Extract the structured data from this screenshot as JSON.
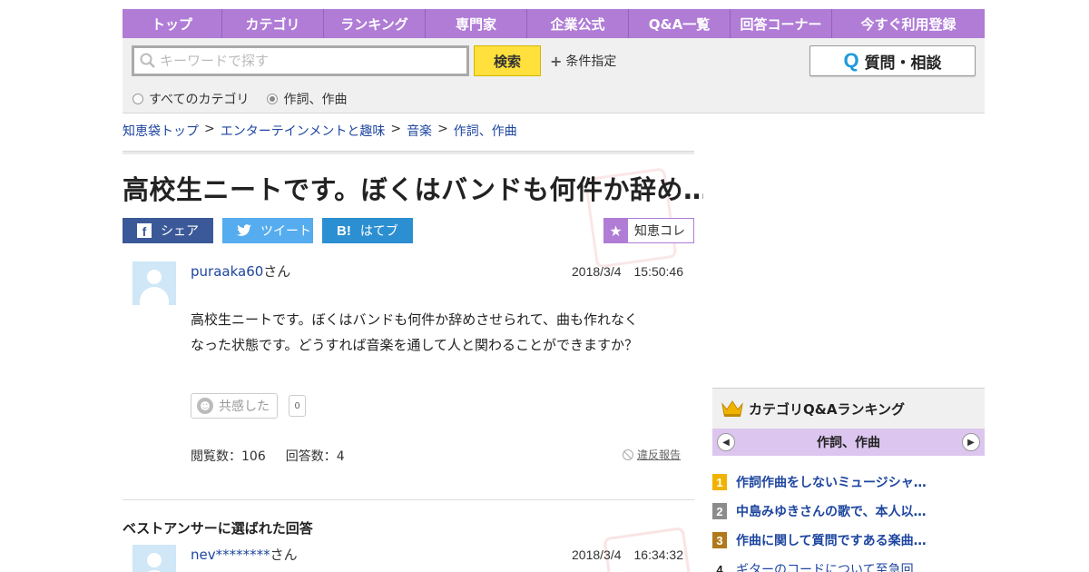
{
  "nav": {
    "items": [
      "トップ",
      "カテゴリ",
      "ランキング",
      "専門家",
      "企業公式",
      "Q&A一覧",
      "回答コーナー",
      "今すぐ利用登録"
    ]
  },
  "search": {
    "placeholder": "キーワードで探す",
    "button": "検索",
    "conditions": "条件指定",
    "ask_button": "質問・相談",
    "ask_icon": "Q",
    "scope_all": "すべてのカテゴリ",
    "scope_current": "作詞、作曲"
  },
  "breadcrumb": [
    "知恵袋トップ",
    "エンターテインメントと趣味",
    "音楽",
    "作詞、作曲"
  ],
  "question": {
    "title": "高校生ニートです。ぼくはバンドも何件か辞め…",
    "user": "puraaka60",
    "honorific": "さん",
    "date": "2018/3/4　15:50:46",
    "body_line1": "高校生ニートです。ぼくはバンドも何件か辞めさせられて、曲も作れなく",
    "body_line2": "なった状態です。どうすれば音楽を通して人と関わることができますか？",
    "empathy_label": "共感した",
    "empathy_count": "0",
    "views": "閲覧数：106",
    "answers": "回答数：4",
    "report": "違反報告"
  },
  "share": {
    "facebook": "シェア",
    "twitter": "ツイート",
    "hatena": "はてブ",
    "chiecore": "知恵コレ"
  },
  "best_answer": {
    "heading": "ベストアンサーに選ばれた回答",
    "user": "nev********",
    "honorific": "さん",
    "date": "2018/3/4　16:34:32"
  },
  "ranking": {
    "title": "カテゴリQ&Aランキング",
    "category": "作詞、作曲",
    "items": [
      {
        "rank": "1",
        "text": "作詞作曲をしないミュージシャ…",
        "color": "#f0b400"
      },
      {
        "rank": "2",
        "text": "中島みゆきさんの歌で、本人以…",
        "color": "#8c8c8c"
      },
      {
        "rank": "3",
        "text": "作曲に関して質問ですある楽曲…",
        "color": "#b07a1c"
      },
      {
        "rank": "4",
        "text": "ギターのコードについて至急回…",
        "color": ""
      }
    ]
  },
  "colors": {
    "nav_bg": "#b07cd6",
    "search_button": "#ffe03c",
    "link": "#1e46a0",
    "facebook": "#3b5998",
    "twitter": "#55acee",
    "hatena": "#2c8fd1"
  }
}
